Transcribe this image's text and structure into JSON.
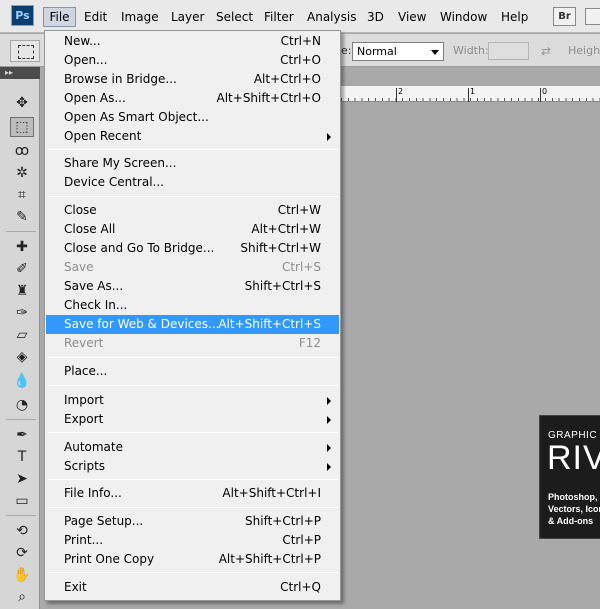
{
  "app": {
    "logo": "Ps"
  },
  "menubar": {
    "items": [
      "File",
      "Edit",
      "Image",
      "Layer",
      "Select",
      "Filter",
      "Analysis",
      "3D",
      "View",
      "Window",
      "Help"
    ],
    "bridge_button": "Br"
  },
  "options": {
    "style_label": "e:",
    "style_value": "Normal",
    "width_label": "Width:",
    "height_label": "Heigh"
  },
  "tools": {
    "collapse_glyph": "▸▸"
  },
  "ruler": {
    "labels": [
      "2",
      "1",
      "0"
    ]
  },
  "banner": {
    "line1": "GRAPHIC",
    "line2": "RIV",
    "lines": [
      "Photoshop,",
      "Vectors, Icon",
      "& Add-ons"
    ]
  },
  "file_menu": {
    "items": [
      {
        "label": "New...",
        "shortcut": "Ctrl+N"
      },
      {
        "label": "Open...",
        "shortcut": "Ctrl+O"
      },
      {
        "label": "Browse in Bridge...",
        "shortcut": "Alt+Ctrl+O"
      },
      {
        "label": "Open As...",
        "shortcut": "Alt+Shift+Ctrl+O"
      },
      {
        "label": "Open As Smart Object...",
        "shortcut": ""
      },
      {
        "label": "Open Recent",
        "shortcut": ""
      },
      {
        "label": "Share My Screen...",
        "shortcut": ""
      },
      {
        "label": "Device Central...",
        "shortcut": ""
      },
      {
        "label": "Close",
        "shortcut": "Ctrl+W"
      },
      {
        "label": "Close All",
        "shortcut": "Alt+Ctrl+W"
      },
      {
        "label": "Close and Go To Bridge...",
        "shortcut": "Shift+Ctrl+W"
      },
      {
        "label": "Save",
        "shortcut": "Ctrl+S"
      },
      {
        "label": "Save As...",
        "shortcut": "Shift+Ctrl+S"
      },
      {
        "label": "Check In...",
        "shortcut": ""
      },
      {
        "label": "Save for Web & Devices...",
        "shortcut": "Alt+Shift+Ctrl+S"
      },
      {
        "label": "Revert",
        "shortcut": "F12"
      },
      {
        "label": "Place...",
        "shortcut": ""
      },
      {
        "label": "Import",
        "shortcut": ""
      },
      {
        "label": "Export",
        "shortcut": ""
      },
      {
        "label": "Automate",
        "shortcut": ""
      },
      {
        "label": "Scripts",
        "shortcut": ""
      },
      {
        "label": "File Info...",
        "shortcut": "Alt+Shift+Ctrl+I"
      },
      {
        "label": "Page Setup...",
        "shortcut": "Shift+Ctrl+P"
      },
      {
        "label": "Print...",
        "shortcut": "Ctrl+P"
      },
      {
        "label": "Print One Copy",
        "shortcut": "Alt+Shift+Ctrl+P"
      },
      {
        "label": "Exit",
        "shortcut": "Ctrl+Q"
      }
    ]
  }
}
